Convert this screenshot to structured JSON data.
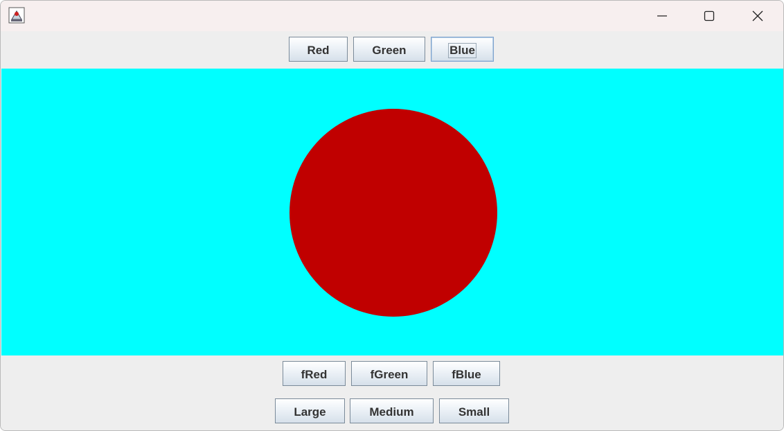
{
  "window": {
    "icons": {
      "app": "java-cup-icon",
      "minimize": "minimize-icon",
      "maximize": "maximize-icon",
      "close": "close-icon"
    }
  },
  "top_buttons": {
    "red": "Red",
    "green": "Green",
    "blue": "Blue"
  },
  "canvas": {
    "background": "#00ffff",
    "circle_color": "#c00000"
  },
  "fill_buttons": {
    "fred": "fRed",
    "fgreen": "fGreen",
    "fblue": "fBlue"
  },
  "size_buttons": {
    "large": "Large",
    "medium": "Medium",
    "small": "Small"
  }
}
